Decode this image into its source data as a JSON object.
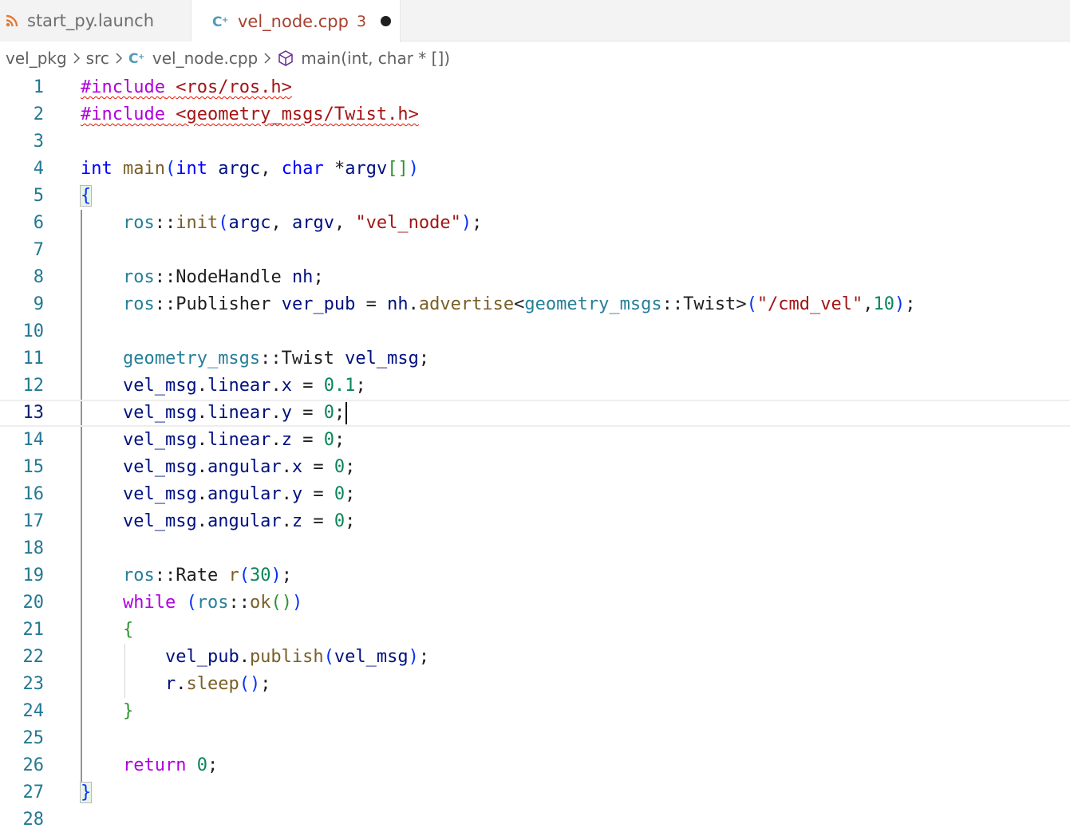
{
  "tabs": [
    {
      "label": "start_py.launch",
      "icon": "rss-icon",
      "active": false
    },
    {
      "label": "vel_node.cpp",
      "icon": "cpp-file-icon",
      "active": true,
      "problems": "3",
      "unsaved": true
    }
  ],
  "breadcrumb": {
    "items": [
      "vel_pkg",
      "src",
      "vel_node.cpp",
      "main(int, char * [])"
    ],
    "separator_icon": "chevron-right-icon",
    "symbol_icon": "cube-symbol-icon"
  },
  "editor": {
    "current_line": 13,
    "line_numbers": [
      "1",
      "2",
      "3",
      "4",
      "5",
      "6",
      "7",
      "8",
      "9",
      "10",
      "11",
      "12",
      "13",
      "14",
      "15",
      "16",
      "17",
      "18",
      "19",
      "20",
      "21",
      "22",
      "23",
      "24",
      "25",
      "26",
      "27",
      "28"
    ],
    "lines": [
      "#include <ros/ros.h>",
      "#include <geometry_msgs/Twist.h>",
      "",
      "int main(int argc, char *argv[])",
      "{",
      "    ros::init(argc, argv, \"vel_node\");",
      "",
      "    ros::NodeHandle nh;",
      "    ros::Publisher ver_pub = nh.advertise<geometry_msgs::Twist>(\"/cmd_vel\",10);",
      "",
      "    geometry_msgs::Twist vel_msg;",
      "    vel_msg.linear.x = 0.1;",
      "    vel_msg.linear.y = 0;",
      "    vel_msg.linear.z = 0;",
      "    vel_msg.angular.x = 0;",
      "    vel_msg.angular.y = 0;",
      "    vel_msg.angular.z = 0;",
      "",
      "    ros::Rate r(30);",
      "    while (ros::ok())",
      "    {",
      "        vel_pub.publish(vel_msg);",
      "        r.sleep();",
      "    }",
      "",
      "    return 0;",
      "}",
      ""
    ]
  },
  "colors": {
    "accent_tab_text": "#a8412f",
    "line_number": "#237893",
    "preprocessor": "#af00db",
    "string": "#a31515",
    "keyword": "#0000ff",
    "function": "#795e26",
    "variable": "#001080",
    "type": "#267f99",
    "number": "#098658",
    "error_squiggle": "#e51400"
  }
}
